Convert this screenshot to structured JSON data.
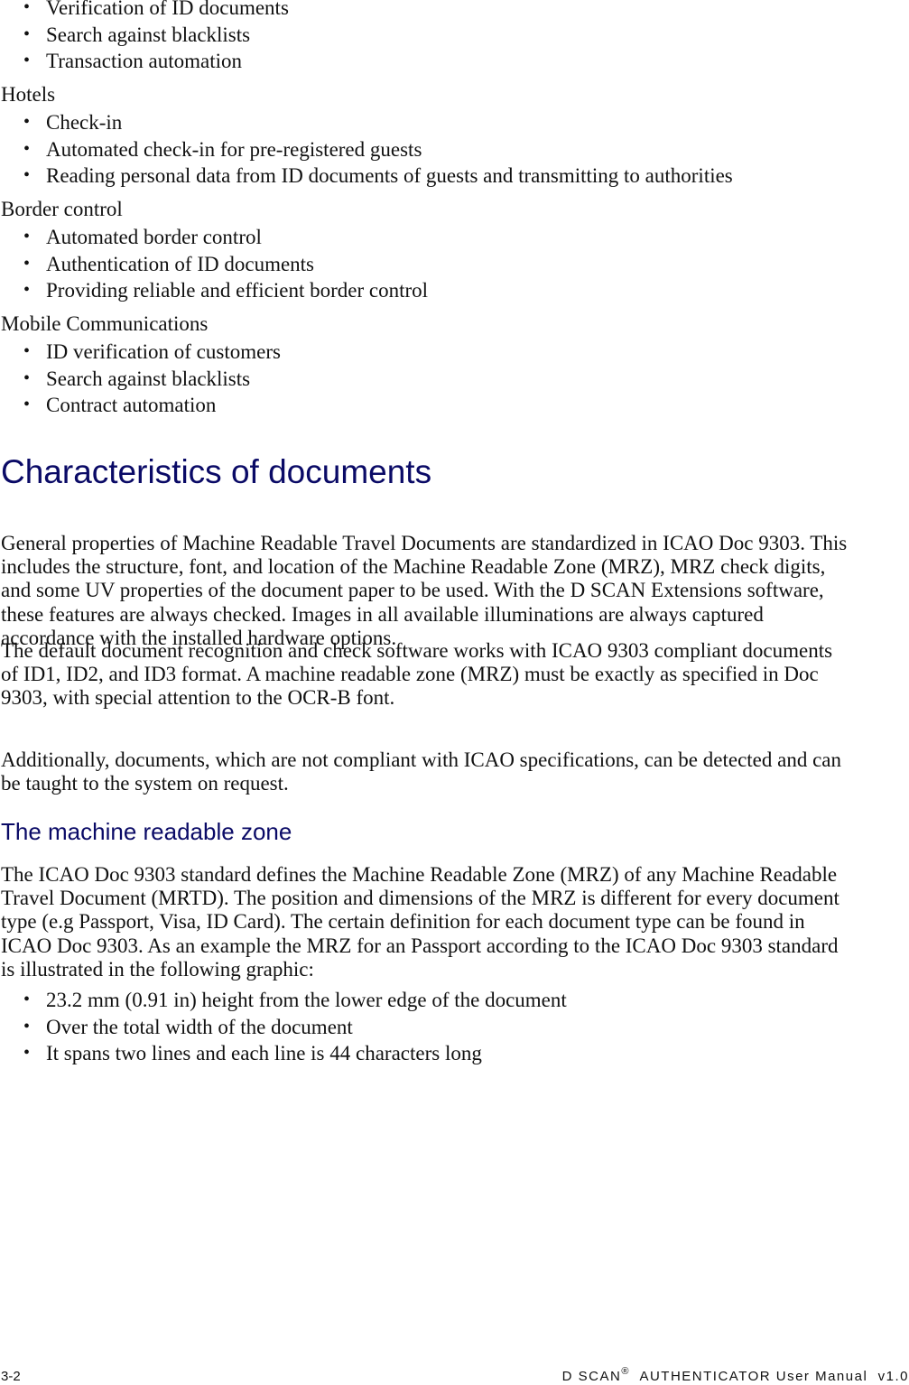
{
  "intro_list": [
    "Verification of ID documents",
    "Search against blacklists",
    "Transaction automation"
  ],
  "groups": [
    {
      "label": "Hotels",
      "items": [
        "Check-in",
        "Automated check-in for pre-registered guests",
        "Reading personal data from ID documents of guests and transmitting to authorities"
      ]
    },
    {
      "label": "Border control",
      "items": [
        "Automated border control",
        "Authentication of ID documents",
        "Providing reliable and efficient border control"
      ]
    },
    {
      "label": "Mobile Communications",
      "items": [
        "ID verification of customers",
        "Search against blacklists",
        "Contract automation"
      ]
    }
  ],
  "bullet_glyph": "•",
  "section": {
    "title": "Characteristics of documents",
    "paragraphs": [
      [
        "General properties of Machine Readable Travel Documents are standardized in ICAO Doc 9303. This",
        "includes the structure, font, and location of the Machine Readable Zone (MRZ), MRZ check digits,",
        "and some UV properties of the document paper to be used. With the D SCAN Extensions software,",
        "these features are always checked. Images in all available illuminations are always captured",
        "accordance with the installed hardware options."
      ],
      [
        "The default document recognition and check software works with ICAO 9303 compliant documents",
        "of ID1, ID2, and ID3 format. A machine readable zone (MRZ) must be exactly as specified in Doc",
        "9303, with special attention to the OCR-B font."
      ],
      [
        "Additionally, documents, which are not compliant with ICAO specifications, can be detected and can",
        "be taught to the system on request."
      ]
    ]
  },
  "subsection": {
    "title": "The machine readable zone",
    "paragraph": [
      "The ICAO Doc 9303 standard defines the Machine Readable Zone (MRZ) of any Machine Readable",
      "Travel Document (MRTD). The position and dimensions of the MRZ is different for every document",
      "type (e.g Passport, Visa, ID Card). The certain definition for each document type can be found in",
      "ICAO Doc 9303. As an example the MRZ for an Passport according to the ICAO Doc 9303 standard",
      "is illustrated in the following graphic:"
    ],
    "items": [
      "23.2 mm (0.91 in) height from the lower edge of the document",
      "Over the total width of the document",
      "It spans two lines and each line is 44 characters long"
    ]
  },
  "footer": {
    "page_number": "3-2",
    "product": "D SCAN",
    "registered_mark": "®",
    "manual_title": "AUTHENTICATOR User Manual",
    "version": "v1.0"
  },
  "colors": {
    "heading": "#0a0a66",
    "text": "#111111"
  }
}
